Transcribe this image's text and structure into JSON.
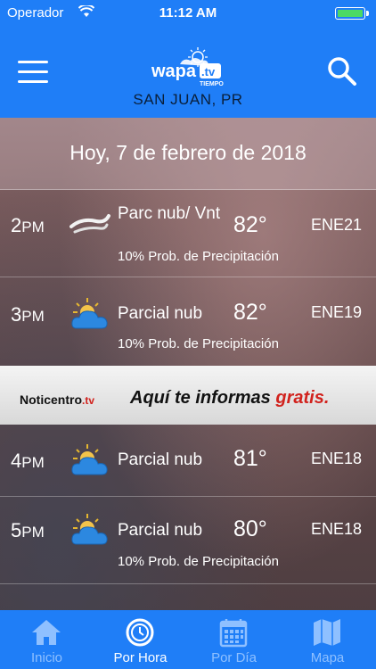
{
  "status_bar": {
    "carrier": "Operador",
    "time": "11:12 AM",
    "battery_color": "#4cd964"
  },
  "header": {
    "location": "SAN JUAN, PR",
    "logo_text": "wapa.tv TIEMPO",
    "bg_color": "#1f7ef7"
  },
  "date_label": "Hoy, 7 de febrero de 2018",
  "hours": [
    {
      "hour": "2",
      "ampm": "PM",
      "condition": "Parc nub/ Vnt",
      "temp": "82°",
      "wind": "ENE21",
      "precip": "10% Prob. de Precipitación",
      "icon": "wind-icon"
    },
    {
      "hour": "3",
      "ampm": "PM",
      "condition": "Parcial nub",
      "temp": "82°",
      "wind": "ENE19",
      "precip": "10% Prob. de Precipitación",
      "icon": "partly-cloudy-icon"
    },
    {
      "hour": "4",
      "ampm": "PM",
      "condition": "Parcial nub",
      "temp": "81°",
      "wind": "ENE18",
      "precip": "",
      "icon": "partly-cloudy-icon"
    },
    {
      "hour": "5",
      "ampm": "PM",
      "condition": "Parcial nub",
      "temp": "80°",
      "wind": "ENE18",
      "precip": "10% Prob. de Precipitación",
      "icon": "partly-cloudy-icon"
    }
  ],
  "ad": {
    "brand": "Noticentro",
    "brand_suffix": ".tv",
    "slogan": "Aquí te informas",
    "slogan_highlight": "gratis."
  },
  "tabs": [
    {
      "label": "Inicio",
      "icon": "home-icon"
    },
    {
      "label": "Por Hora",
      "icon": "clock-icon",
      "active": true
    },
    {
      "label": "Por Día",
      "icon": "calendar-icon"
    },
    {
      "label": "Mapa",
      "icon": "map-icon"
    }
  ]
}
